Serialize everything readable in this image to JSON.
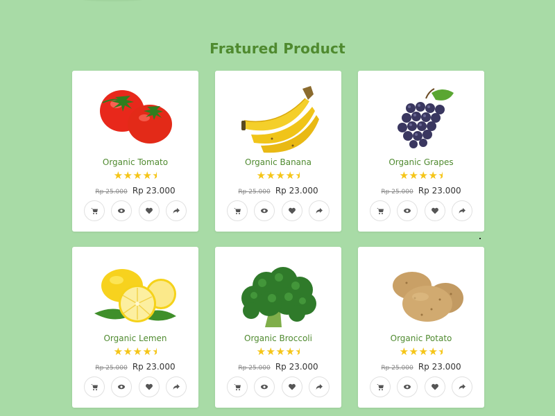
{
  "section": {
    "title": "Fratured Product"
  },
  "products": [
    {
      "name": "Organic Tomato",
      "old_price": "Rp 25.000",
      "price": "Rp 23.000",
      "rating": 4.5,
      "image": "tomato-image"
    },
    {
      "name": "Organic Banana",
      "old_price": "Rp 25.000",
      "price": "Rp 23.000",
      "rating": 4.5,
      "image": "banana-image"
    },
    {
      "name": "Organic Grapes",
      "old_price": "Rp 25.000",
      "price": "Rp 23.000",
      "rating": 4.5,
      "image": "grapes-image"
    },
    {
      "name": "Organic Lemen",
      "old_price": "Rp 25.000",
      "price": "Rp 23.000",
      "rating": 4.5,
      "image": "lemon-image"
    },
    {
      "name": "Organic Broccoli",
      "old_price": "Rp 25.000",
      "price": "Rp 23.000",
      "rating": 4.5,
      "image": "broccoli-image"
    },
    {
      "name": "Organic Potato",
      "old_price": "Rp 25.000",
      "price": "Rp 23.000",
      "rating": 4.5,
      "image": "potato-image"
    }
  ],
  "actions": [
    "cart-icon",
    "eye-icon",
    "heart-icon",
    "share-icon"
  ],
  "colors": {
    "background": "#a8dba6",
    "accent": "#4f8a2f",
    "star": "#f5c518"
  }
}
